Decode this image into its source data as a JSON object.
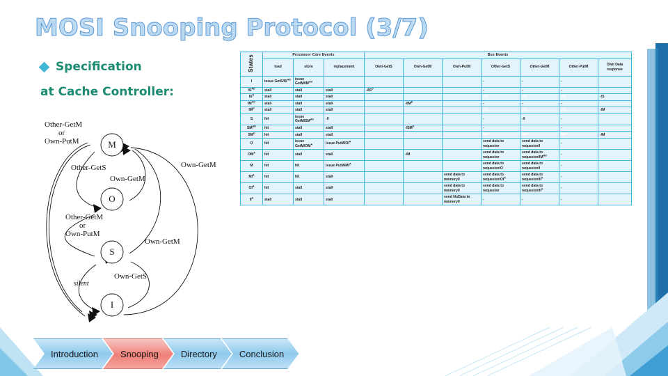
{
  "slide": {
    "title": "MOSI Snooping Protocol (3/7)",
    "bullet": "Specification",
    "bullet_line2": "at Cache Controller:",
    "accent_blue": "#41b6e6",
    "title_color": "#bcd9f2",
    "bullet_color": "#1d8c72",
    "grey_cell_color": "#767676",
    "red_text_color": "#c00000"
  },
  "diagram": {
    "states": [
      "M",
      "O",
      "S",
      "I"
    ],
    "labels": [
      "Other-GetM",
      "or",
      "Own-PutM",
      "Other-GetS",
      "Own-GetM",
      "Own-GetM",
      "Other-GetM",
      "or",
      "Own-PutM",
      "Own-GetM",
      "Own-GetS",
      "silent"
    ]
  },
  "table": {
    "states_header": "States",
    "group_headers": [
      "Processor Core Events",
      "Bus Events"
    ],
    "columns": [
      "load",
      "store",
      "replacement",
      "Own-GetS",
      "Own-GetM",
      "Own-PutM",
      "Other-GetS",
      "Other-GetM",
      "Other-PutM",
      "Own Data response"
    ],
    "rows": [
      {
        "state": "I",
        "state_sup": "",
        "red": false,
        "cells": [
          {
            "t": "issue GetS/IS<sup>AD</sup>",
            "na": false
          },
          {
            "t": "issue GetM/IM<sup>AD</sup>",
            "na": false
          },
          {
            "t": "",
            "na": true
          },
          {
            "t": "",
            "na": true
          },
          {
            "t": "",
            "na": true
          },
          {
            "t": "",
            "na": true
          },
          {
            "t": "-",
            "na": false
          },
          {
            "t": "-",
            "na": false
          },
          {
            "t": "-",
            "na": false
          },
          {
            "t": "",
            "na": true
          }
        ]
      },
      {
        "state": "IS",
        "state_sup": "AD",
        "red": false,
        "cells": [
          {
            "t": "stall",
            "na": false
          },
          {
            "t": "stall",
            "na": false
          },
          {
            "t": "stall",
            "na": false
          },
          {
            "t": "-/IS<sup>D</sup>",
            "na": false
          },
          {
            "t": "",
            "na": true
          },
          {
            "t": "",
            "na": true
          },
          {
            "t": "-",
            "na": false
          },
          {
            "t": "-",
            "na": false
          },
          {
            "t": "-",
            "na": false
          },
          {
            "t": "",
            "na": true
          }
        ]
      },
      {
        "state": "IS",
        "state_sup": "D",
        "red": false,
        "cells": [
          {
            "t": "stall",
            "na": false
          },
          {
            "t": "stall",
            "na": false
          },
          {
            "t": "stall",
            "na": false
          },
          {
            "t": "",
            "na": true
          },
          {
            "t": "",
            "na": true
          },
          {
            "t": "",
            "na": true
          },
          {
            "t": "(A)",
            "na": true
          },
          {
            "t": "(A)",
            "na": true
          },
          {
            "t": "(A)",
            "na": true
          },
          {
            "t": "-/S",
            "na": false
          }
        ]
      },
      {
        "state": "IM",
        "state_sup": "AD",
        "red": false,
        "cells": [
          {
            "t": "stall",
            "na": false
          },
          {
            "t": "stall",
            "na": false
          },
          {
            "t": "stall",
            "na": false
          },
          {
            "t": "",
            "na": true
          },
          {
            "t": "-/IM<sup>D</sup>",
            "na": false
          },
          {
            "t": "",
            "na": true
          },
          {
            "t": "-",
            "na": false
          },
          {
            "t": "-",
            "na": false
          },
          {
            "t": "-",
            "na": false
          },
          {
            "t": "",
            "na": true
          }
        ]
      },
      {
        "state": "IM",
        "state_sup": "D",
        "red": false,
        "cells": [
          {
            "t": "stall",
            "na": false
          },
          {
            "t": "stall",
            "na": false
          },
          {
            "t": "stall",
            "na": false
          },
          {
            "t": "",
            "na": true
          },
          {
            "t": "",
            "na": true
          },
          {
            "t": "",
            "na": true
          },
          {
            "t": "(A)",
            "na": true
          },
          {
            "t": "(A)",
            "na": true
          },
          {
            "t": "(A)",
            "na": true
          },
          {
            "t": "-/M",
            "na": false
          }
        ]
      },
      {
        "state": "S",
        "state_sup": "",
        "red": false,
        "cells": [
          {
            "t": "hit",
            "na": false
          },
          {
            "t": "issue GetM/SM<sup>AD</sup>",
            "na": false
          },
          {
            "t": "-/I",
            "na": false
          },
          {
            "t": "",
            "na": true
          },
          {
            "t": "",
            "na": true
          },
          {
            "t": "",
            "na": true
          },
          {
            "t": "-",
            "na": false
          },
          {
            "t": "-/I",
            "na": false
          },
          {
            "t": "-",
            "na": false
          },
          {
            "t": "",
            "na": true
          }
        ]
      },
      {
        "state": "SM",
        "state_sup": "AD",
        "red": false,
        "cells": [
          {
            "t": "hit",
            "na": false
          },
          {
            "t": "stall",
            "na": false
          },
          {
            "t": "stall",
            "na": false
          },
          {
            "t": "",
            "na": true
          },
          {
            "t": "-/SM<sup>D</sup>",
            "na": false
          },
          {
            "t": "",
            "na": true
          },
          {
            "t": "-",
            "na": false
          },
          {
            "t": "",
            "na": false
          },
          {
            "t": "-",
            "na": false
          },
          {
            "t": "",
            "na": true
          }
        ]
      },
      {
        "state": "SM",
        "state_sup": "D",
        "red": false,
        "cells": [
          {
            "t": "hit",
            "na": false
          },
          {
            "t": "stall",
            "na": false
          },
          {
            "t": "stall",
            "na": false
          },
          {
            "t": "",
            "na": true
          },
          {
            "t": "",
            "na": true
          },
          {
            "t": "",
            "na": true
          },
          {
            "t": "(A)",
            "na": true
          },
          {
            "t": "(A)",
            "na": true
          },
          {
            "t": "(A)",
            "na": true
          },
          {
            "t": "-/M",
            "na": false
          }
        ]
      },
      {
        "state": "O",
        "state_sup": "",
        "red": true,
        "cells": [
          {
            "t": "hit",
            "na": false
          },
          {
            "t": "issue GetM/OM<sup>A</sup>",
            "na": false
          },
          {
            "t": "issue PutM/OI<sup>A</sup>",
            "na": false
          },
          {
            "t": "",
            "na": true
          },
          {
            "t": "",
            "na": true
          },
          {
            "t": "",
            "na": true
          },
          {
            "t": "send data to requestor",
            "na": false
          },
          {
            "t": "send data to requestor/I",
            "na": false
          },
          {
            "t": "-",
            "na": false
          },
          {
            "t": "",
            "na": true
          }
        ]
      },
      {
        "state": "OM",
        "state_sup": "A",
        "red": true,
        "cells": [
          {
            "t": "hit",
            "na": false
          },
          {
            "t": "stall",
            "na": false
          },
          {
            "t": "stall",
            "na": false
          },
          {
            "t": "",
            "na": true
          },
          {
            "t": "-/M",
            "na": false
          },
          {
            "t": "",
            "na": true
          },
          {
            "t": "send data to requestor",
            "na": false
          },
          {
            "t": "send data to requestor/IM<sup>AD</sup>",
            "na": false
          },
          {
            "t": "-",
            "na": false
          },
          {
            "t": "",
            "na": true
          }
        ]
      },
      {
        "state": "M",
        "state_sup": "",
        "red": false,
        "cells": [
          {
            "t": "hit",
            "na": false
          },
          {
            "t": "hit",
            "na": false
          },
          {
            "t": "issue PutM/MI<sup>A</sup>",
            "na": false
          },
          {
            "t": "",
            "na": true
          },
          {
            "t": "",
            "na": true
          },
          {
            "t": "",
            "na": true
          },
          {
            "t": "send data to requestor/O",
            "na": false
          },
          {
            "t": "send data to requestor/I",
            "na": false
          },
          {
            "t": "-",
            "na": false
          },
          {
            "t": "",
            "na": true
          }
        ]
      },
      {
        "state": "MI",
        "state_sup": "A",
        "red": false,
        "cells": [
          {
            "t": "hit",
            "na": false
          },
          {
            "t": "hit",
            "na": false
          },
          {
            "t": "stall",
            "na": false
          },
          {
            "t": "",
            "na": true
          },
          {
            "t": "",
            "na": true
          },
          {
            "t": "send data to memory/I",
            "na": false
          },
          {
            "t": "send data to requestor/OI<sup>A</sup>",
            "na": false
          },
          {
            "t": "send data to requestor/II<sup>A</sup>",
            "na": false
          },
          {
            "t": "-",
            "na": false
          },
          {
            "t": "",
            "na": true
          }
        ]
      },
      {
        "state": "OI",
        "state_sup": "A",
        "red": true,
        "cells": [
          {
            "t": "hit",
            "na": false
          },
          {
            "t": "stall",
            "na": false
          },
          {
            "t": "stall",
            "na": false
          },
          {
            "t": "",
            "na": true
          },
          {
            "t": "",
            "na": true
          },
          {
            "t": "send data to memory/I",
            "na": false
          },
          {
            "t": "send data to requestor",
            "na": false
          },
          {
            "t": "send data to requestor/II<sup>A</sup>",
            "na": false
          },
          {
            "t": "-",
            "na": false
          },
          {
            "t": "",
            "na": true
          }
        ]
      },
      {
        "state": "II",
        "state_sup": "A",
        "red": false,
        "cells": [
          {
            "t": "stall",
            "na": false
          },
          {
            "t": "stall",
            "na": false
          },
          {
            "t": "stall",
            "na": false
          },
          {
            "t": "",
            "na": true
          },
          {
            "t": "",
            "na": true
          },
          {
            "t": "send NoData to memory/I",
            "na": false
          },
          {
            "t": "-",
            "na": false
          },
          {
            "t": "-",
            "na": false
          },
          {
            "t": "-",
            "na": false
          },
          {
            "t": "",
            "na": true
          }
        ]
      }
    ]
  },
  "nav": {
    "items": [
      {
        "label": "Introduction",
        "active": false
      },
      {
        "label": "Snooping",
        "active": true
      },
      {
        "label": "Directory",
        "active": false
      },
      {
        "label": "Conclusion",
        "active": false
      }
    ]
  }
}
